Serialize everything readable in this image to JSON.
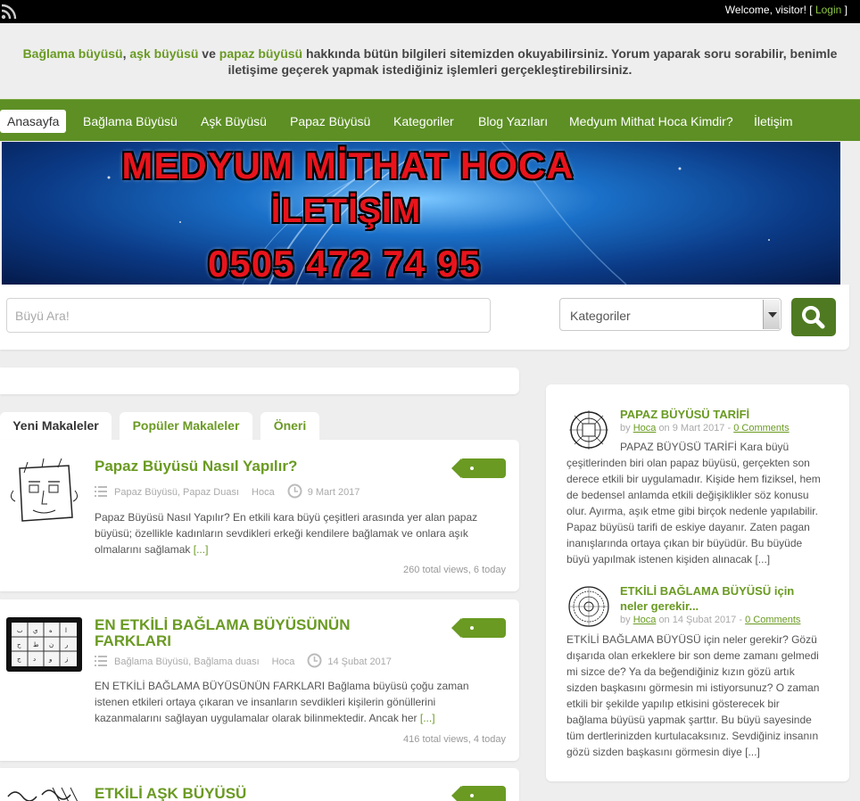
{
  "topbar": {
    "welcome_text": "Welcome, visitor! [",
    "login_label": "Login",
    "welcome_end": "]"
  },
  "intro": {
    "link1": "Bağlama büyüsü",
    "sep1": ", ",
    "link2": "aşk büyüsü",
    "sep2": " ve ",
    "link3": "papaz büyüsü",
    "line1_rest": " hakkında bütün bilgileri sitemizden okuyabilirsiniz. Yorum yaparak soru sorabilir, benimle",
    "line2": "iletişime geçerek yapmak istediğiniz işlemleri gerçekleştirebilirsiniz."
  },
  "nav": {
    "items": [
      {
        "label": "Anasayfa"
      },
      {
        "label": "Bağlama Büyüsü"
      },
      {
        "label": "Aşk Büyüsü"
      },
      {
        "label": "Papaz Büyüsü"
      },
      {
        "label": "Kategoriler"
      },
      {
        "label": "Blog Yazıları"
      },
      {
        "label": "Medyum Mithat Hoca Kimdir?"
      },
      {
        "label": "İletişim"
      }
    ]
  },
  "banner": {
    "line1": "MEDYUM MİTHAT HOCA",
    "line2": "İLETİŞİM",
    "line3": "0505 472 74 95"
  },
  "search": {
    "placeholder": "Büyü Ara!",
    "category_label": "Kategoriler"
  },
  "tabs": [
    {
      "label": "Yeni Makaleler"
    },
    {
      "label": "Popüler Makaleler"
    },
    {
      "label": "Öneri"
    }
  ],
  "posts": [
    {
      "title": "Papaz Büyüsü Nasıl Yapılır?",
      "categories": "Papaz Büyüsü, Papaz Duası",
      "author": "Hoca",
      "date": "9 Mart 2017",
      "excerpt_l1": "Papaz Büyüsü Nasıl Yapılır? En etkili kara büyü çeşitleri arasında yer alan papaz",
      "excerpt_l2": "büyüsü; özellikle kadınların sevdikleri erkeği kendilere bağlamak ve onlara aşık",
      "excerpt_l3": "olmalarını sağlamak",
      "more": "[...]",
      "views": "260 total views, 6 today"
    },
    {
      "title_l1": "EN ETKİLİ BAĞLAMA BÜYÜSÜNÜN",
      "title_l2": "FARKLARI",
      "categories": "Bağlama Büyüsü, Bağlama duası",
      "author": "Hoca",
      "date": "14 Şubat 2017",
      "excerpt_l1": "EN ETKİLİ BAĞLAMA BÜYÜSÜNÜN FARKLARI Bağlama büyüsü çoğu zaman",
      "excerpt_l2": "istenen etkileri ortaya çıkaran ve insanların sevdikleri kişilerin gönüllerini",
      "excerpt_l3": "kazanmalarını sağlayan uygulamalar olarak bilinmektedir. Ancak her",
      "more": "[...]",
      "views": "416 total views, 4 today"
    },
    {
      "title": "ETKİLİ AŞK BÜYÜSÜ"
    }
  ],
  "sidebar": {
    "items": [
      {
        "title": "PAPAZ BÜYÜSÜ TARİFİ",
        "by": "by",
        "author": "Hoca",
        "date_text": "on 9 Mart 2017 -",
        "comments": "0 Comments",
        "lines": [
          "PAPAZ BÜYÜSÜ TARİFİ Kara büyü",
          "çeşitlerinden biri olan papaz büyüsü, gerçekten son",
          "derece etkili bir uygulamadır. Kişide hem fiziksel, hem",
          "de bedensel anlamda etkili değişiklikler söz konusu",
          "olur. Ayırma, aşık etme gibi birçok nedenle yapılabilir.",
          "Papaz büyüsü tarifi de eskiye dayanır. Zaten pagan",
          "inanışlarında ortaya çıkan bir büyüdür. Bu büyüde",
          "büyü yapılmak istenen kişiden alınacak [...]"
        ]
      },
      {
        "title_l1": "ETKİLİ BAĞLAMA BÜYÜSÜ için",
        "title_l2": "neler gerekir...",
        "by": "by",
        "author": "Hoca",
        "date_text": "on 14 Şubat 2017 -",
        "comments": "0 Comments",
        "lines": [
          "ETKİLİ BAĞLAMA BÜYÜSÜ için neler gerekir? Gözü",
          "dışarıda olan erkeklere bir son deme zamanı gelmedi",
          "mi sizce de? Ya da beğendiğiniz kızın gözü artık",
          "sizden başkasını görmesin mi istiyorsunuz? O zaman",
          "etkili bir şekilde yapılıp etkisini gösterecek bir",
          "bağlama büyüsü yapmak şarttır. Bu büyü sayesinde",
          "tüm dertlerinizden kurtulacaksınız. Sevdiğiniz insanın",
          "gözü sizden başkasını görmesin diye [...]"
        ]
      }
    ]
  },
  "colors": {
    "accent": "#6a9a22",
    "nav_bg": "#5d8f25",
    "search_btn": "#4f7a22"
  }
}
